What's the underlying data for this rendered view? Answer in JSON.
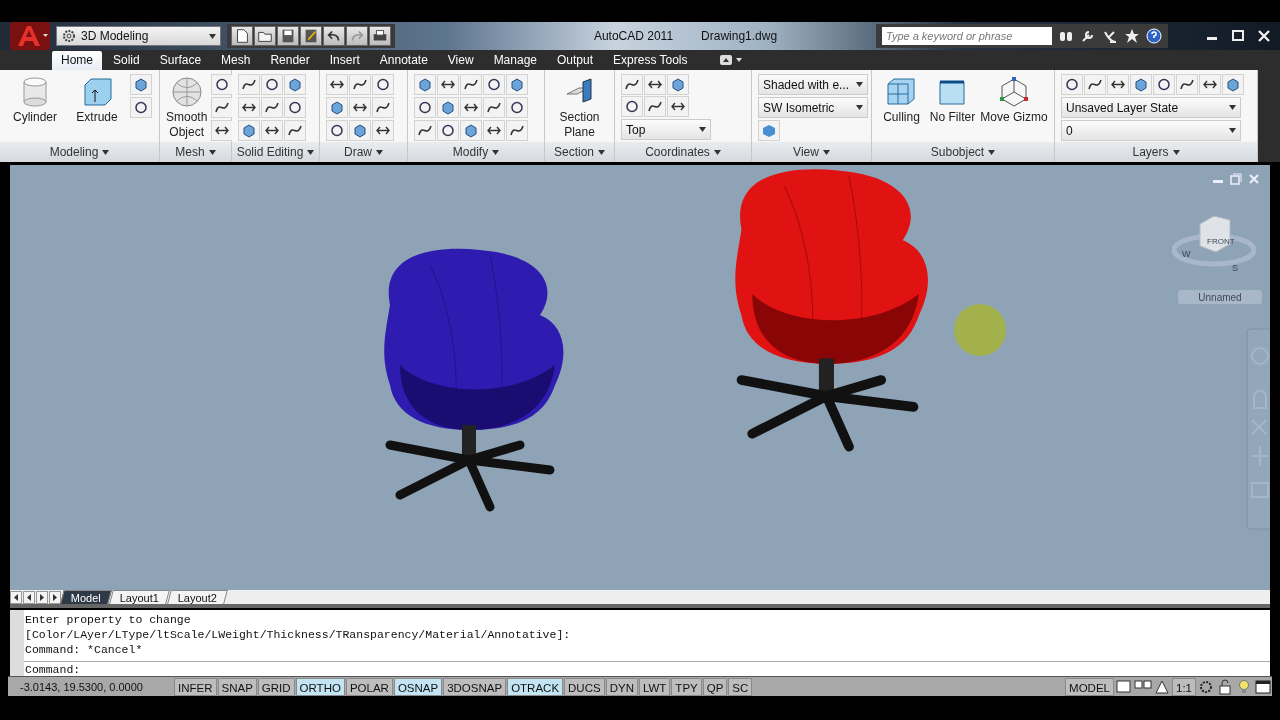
{
  "title_bar": {
    "workspace": "3D Modeling",
    "app_title": "AutoCAD 2011",
    "file_name": "Drawing1.dwg",
    "search": {
      "placeholder": "Type a keyword or phrase"
    }
  },
  "ribbon_tabs": [
    {
      "label": "Home",
      "selected": true
    },
    {
      "label": "Solid",
      "selected": false
    },
    {
      "label": "Surface",
      "selected": false
    },
    {
      "label": "Mesh",
      "selected": false
    },
    {
      "label": "Render",
      "selected": false
    },
    {
      "label": "Insert",
      "selected": false
    },
    {
      "label": "Annotate",
      "selected": false
    },
    {
      "label": "View",
      "selected": false
    },
    {
      "label": "Manage",
      "selected": false
    },
    {
      "label": "Output",
      "selected": false
    },
    {
      "label": "Express Tools",
      "selected": false
    }
  ],
  "panels": [
    {
      "title": "Modeling",
      "large_buttons": [
        "Cylinder",
        "Extrude"
      ]
    },
    {
      "title": "Mesh",
      "large_buttons": [
        "Smooth Object"
      ]
    },
    {
      "title": "Solid Editing"
    },
    {
      "title": "Draw"
    },
    {
      "title": "Modify"
    },
    {
      "title": "Section",
      "large_buttons": [
        "Section Plane"
      ]
    },
    {
      "title": "Coordinates",
      "dropdowns": [
        "Top"
      ]
    },
    {
      "title": "View",
      "dropdowns": [
        "Shaded with e...",
        "SW Isometric"
      ]
    },
    {
      "title": "Subobject",
      "large_buttons": [
        "Culling",
        "No Filter",
        "Move Gizmo"
      ]
    },
    {
      "title": "Layers",
      "dropdowns": [
        "Unsaved Layer State",
        "0"
      ]
    }
  ],
  "viewport": {
    "viewcube": {
      "face": "FRONT",
      "compass": [
        "W",
        "S"
      ],
      "ucs_menu": "Unnamed"
    }
  },
  "layout_tabs": [
    {
      "label": "Model",
      "selected": true
    },
    {
      "label": "Layout1",
      "selected": false
    },
    {
      "label": "Layout2",
      "selected": false
    }
  ],
  "command_history": [
    "Enter property to change",
    "[Color/LAyer/LType/ltScale/LWeight/Thickness/TRansparency/Material/Annotative]:",
    "Command: *Cancel*"
  ],
  "command_prompt": "Command:",
  "status_bar": {
    "coordinates": "-3.0143, 19.5300, 0.0000",
    "toggles": [
      {
        "label": "INFER",
        "on": false
      },
      {
        "label": "SNAP",
        "on": false
      },
      {
        "label": "GRID",
        "on": false
      },
      {
        "label": "ORTHO",
        "on": true
      },
      {
        "label": "POLAR",
        "on": false
      },
      {
        "label": "OSNAP",
        "on": true
      },
      {
        "label": "3DOSNAP",
        "on": false
      },
      {
        "label": "OTRACK",
        "on": true
      },
      {
        "label": "DUCS",
        "on": false
      },
      {
        "label": "DYN",
        "on": false
      },
      {
        "label": "LWT",
        "on": false
      },
      {
        "label": "TPY",
        "on": false
      },
      {
        "label": "QP",
        "on": false
      },
      {
        "label": "SC",
        "on": false
      }
    ],
    "space": "MODEL",
    "scale": "1:1"
  }
}
